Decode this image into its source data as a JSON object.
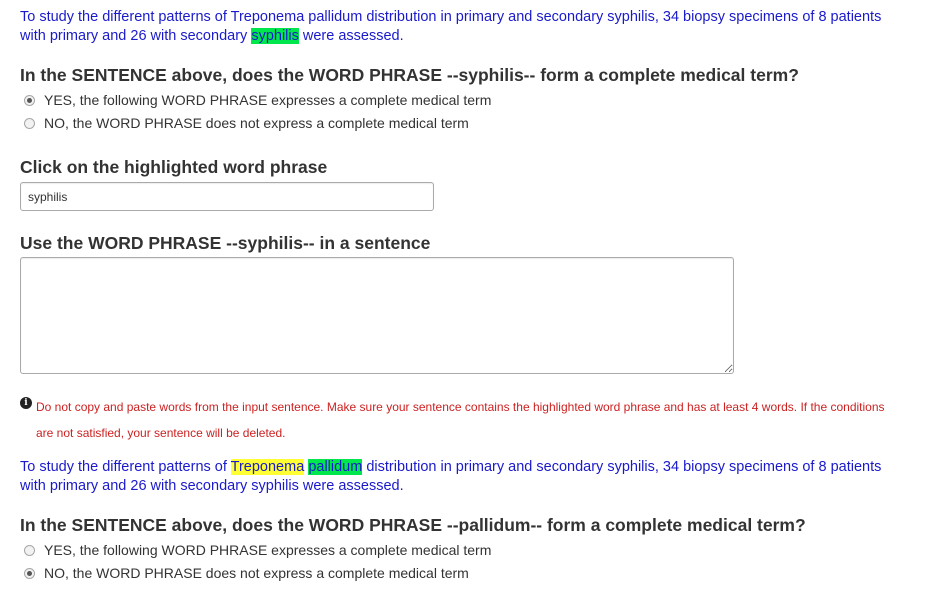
{
  "block1": {
    "sentence_before": "To study the different patterns of Treponema pallidum distribution in primary and secondary syphilis, 34 biopsy specimens of 8 patients with primary and 26 with secondary ",
    "sentence_highlight": "syphilis",
    "sentence_after": " were assessed.",
    "question": "In the SENTENCE above, does the WORD PHRASE --syphilis-- form a complete medical term?",
    "option_yes": "YES, the following WORD PHRASE expresses a complete medical term",
    "option_no": "NO, the WORD PHRASE does not express a complete medical term",
    "selected": "yes",
    "click_heading": "Click on the highlighted word phrase",
    "click_input_value": "syphilis",
    "use_heading": "Use the WORD PHRASE --syphilis-- in a sentence",
    "textarea_value": "",
    "warning_icon": "info-icon",
    "warning": "Do not copy and paste words from the input sentence. Make sure your sentence contains the highlighted word phrase and has at least 4 words. If the conditions are not satisfied, your sentence will be deleted."
  },
  "block2": {
    "sentence_before": "To study the different patterns of ",
    "highlight_yellow": "Treponema",
    "highlight_green": "pallidum",
    "sentence_after": " distribution in primary and secondary syphilis, 34 biopsy specimens of 8 patients with primary and 26 with secondary syphilis were assessed.",
    "question": "In the SENTENCE above, does the WORD PHRASE --pallidum-- form a complete medical term?",
    "option_yes": "YES, the following WORD PHRASE expresses a complete medical term",
    "option_no": "NO, the WORD PHRASE does not express a complete medical term",
    "selected": "no"
  },
  "colors": {
    "sentence_text": "#1a1acc",
    "highlight_green": "#00e64d",
    "highlight_yellow": "#ffff33",
    "warning_text": "#cc2222"
  }
}
